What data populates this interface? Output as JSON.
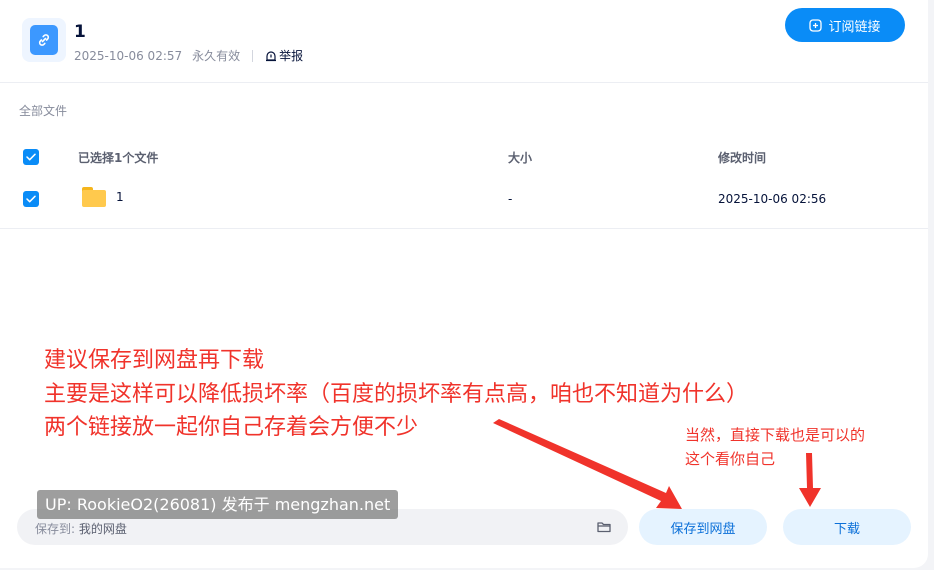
{
  "share": {
    "title": "1",
    "date": "2025-10-06 02:57",
    "validity": "永久有效",
    "report_label": "举报",
    "subscribe_label": "订阅链接"
  },
  "breadcrumb": "全部文件",
  "table": {
    "header": {
      "selected_label": "已选择1个文件",
      "size_label": "大小",
      "time_label": "修改时间"
    },
    "rows": [
      {
        "name": "1",
        "size": "-",
        "modified": "2025-10-06 02:56",
        "checked": true
      }
    ]
  },
  "annotation": {
    "line1": "建议保存到网盘再下载",
    "line2": "主要是这样可以降低损坏率（百度的损坏率有点高，咱也不知道为什么）",
    "line3": "两个链接放一起你自己存着会方便不少",
    "side_line1": "当然，直接下载也是可以的",
    "side_line2": "这个看你自己"
  },
  "watermark": "UP: RookieO2(26081) 发布于 mengzhan.net",
  "bottom_bar": {
    "save_to_label": "保存到:",
    "save_to_value": "我的网盘",
    "save_button": "保存到网盘",
    "download_button": "下载"
  },
  "colors": {
    "accent": "#0a8cf7",
    "annotation": "#f0332b",
    "folder": "#ffc94d"
  }
}
